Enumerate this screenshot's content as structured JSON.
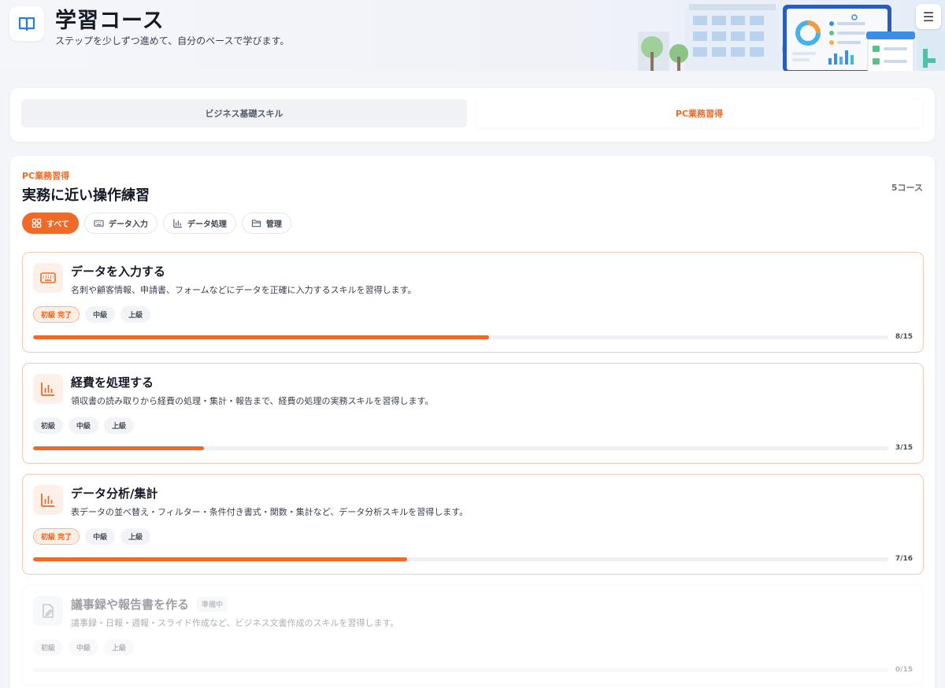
{
  "header": {
    "title": "学習コース",
    "subtitle": "ステップを少しずつ進めて、自分のペースで学びます。",
    "logo_icon": "book-icon",
    "menu_icon": "☰"
  },
  "tabs": [
    {
      "label": "ビジネス基礎スキル",
      "active": false
    },
    {
      "label": "PC業務習得",
      "active": true
    }
  ],
  "section": {
    "eyebrow": "PC業務習得",
    "title": "実務に近い操作練習",
    "count": "5コース"
  },
  "filters": [
    {
      "label": "すべて",
      "icon": "grid-icon",
      "active": true
    },
    {
      "label": "データ入力",
      "icon": "keyboard-icon",
      "active": false
    },
    {
      "label": "データ処理",
      "icon": "bar-chart-icon",
      "active": false
    },
    {
      "label": "管理",
      "icon": "folder-icon",
      "active": false
    }
  ],
  "courses": [
    {
      "title": "データを入力する",
      "description": "名刺や顧客情報、申請書、フォームなどにデータを正確に入力するスキルを習得します。",
      "icon": "keyboard-icon",
      "levels": [
        {
          "label": "初級 完了",
          "done": true
        },
        {
          "label": "中級",
          "done": false
        },
        {
          "label": "上級",
          "done": false
        }
      ],
      "progress_text": "8/15",
      "progress": 0.533,
      "status": ""
    },
    {
      "title": "経費を処理する",
      "description": "領収書の読み取りから経費の処理・集計・報告まで、経費の処理の実務スキルを習得します。",
      "icon": "bar-chart-icon",
      "levels": [
        {
          "label": "初級",
          "done": false
        },
        {
          "label": "中級",
          "done": false
        },
        {
          "label": "上級",
          "done": false
        }
      ],
      "progress_text": "3/15",
      "progress": 0.2,
      "status": ""
    },
    {
      "title": "データ分析/集計",
      "description": "表データの並べ替え・フィルター・条件付き書式・関数・集計など、データ分析スキルを習得します。",
      "icon": "bar-chart-icon",
      "levels": [
        {
          "label": "初級 完了",
          "done": true
        },
        {
          "label": "中級",
          "done": false
        },
        {
          "label": "上級",
          "done": false
        }
      ],
      "progress_text": "7/16",
      "progress": 0.4375,
      "status": ""
    },
    {
      "title": "議事録や報告書を作る",
      "description": "議事録・日報・週報・スライド作成など、ビジネス文書作成のスキルを習得します。",
      "icon": "document-edit-icon",
      "levels": [
        {
          "label": "初級",
          "done": false
        },
        {
          "label": "中級",
          "done": false
        },
        {
          "label": "上級",
          "done": false
        }
      ],
      "progress_text": "0/15",
      "progress": 0,
      "status": "準備中"
    }
  ],
  "colors": {
    "accent": "#ef6a28",
    "accent_soft": "#fdf0e8",
    "text": "#161a26"
  }
}
